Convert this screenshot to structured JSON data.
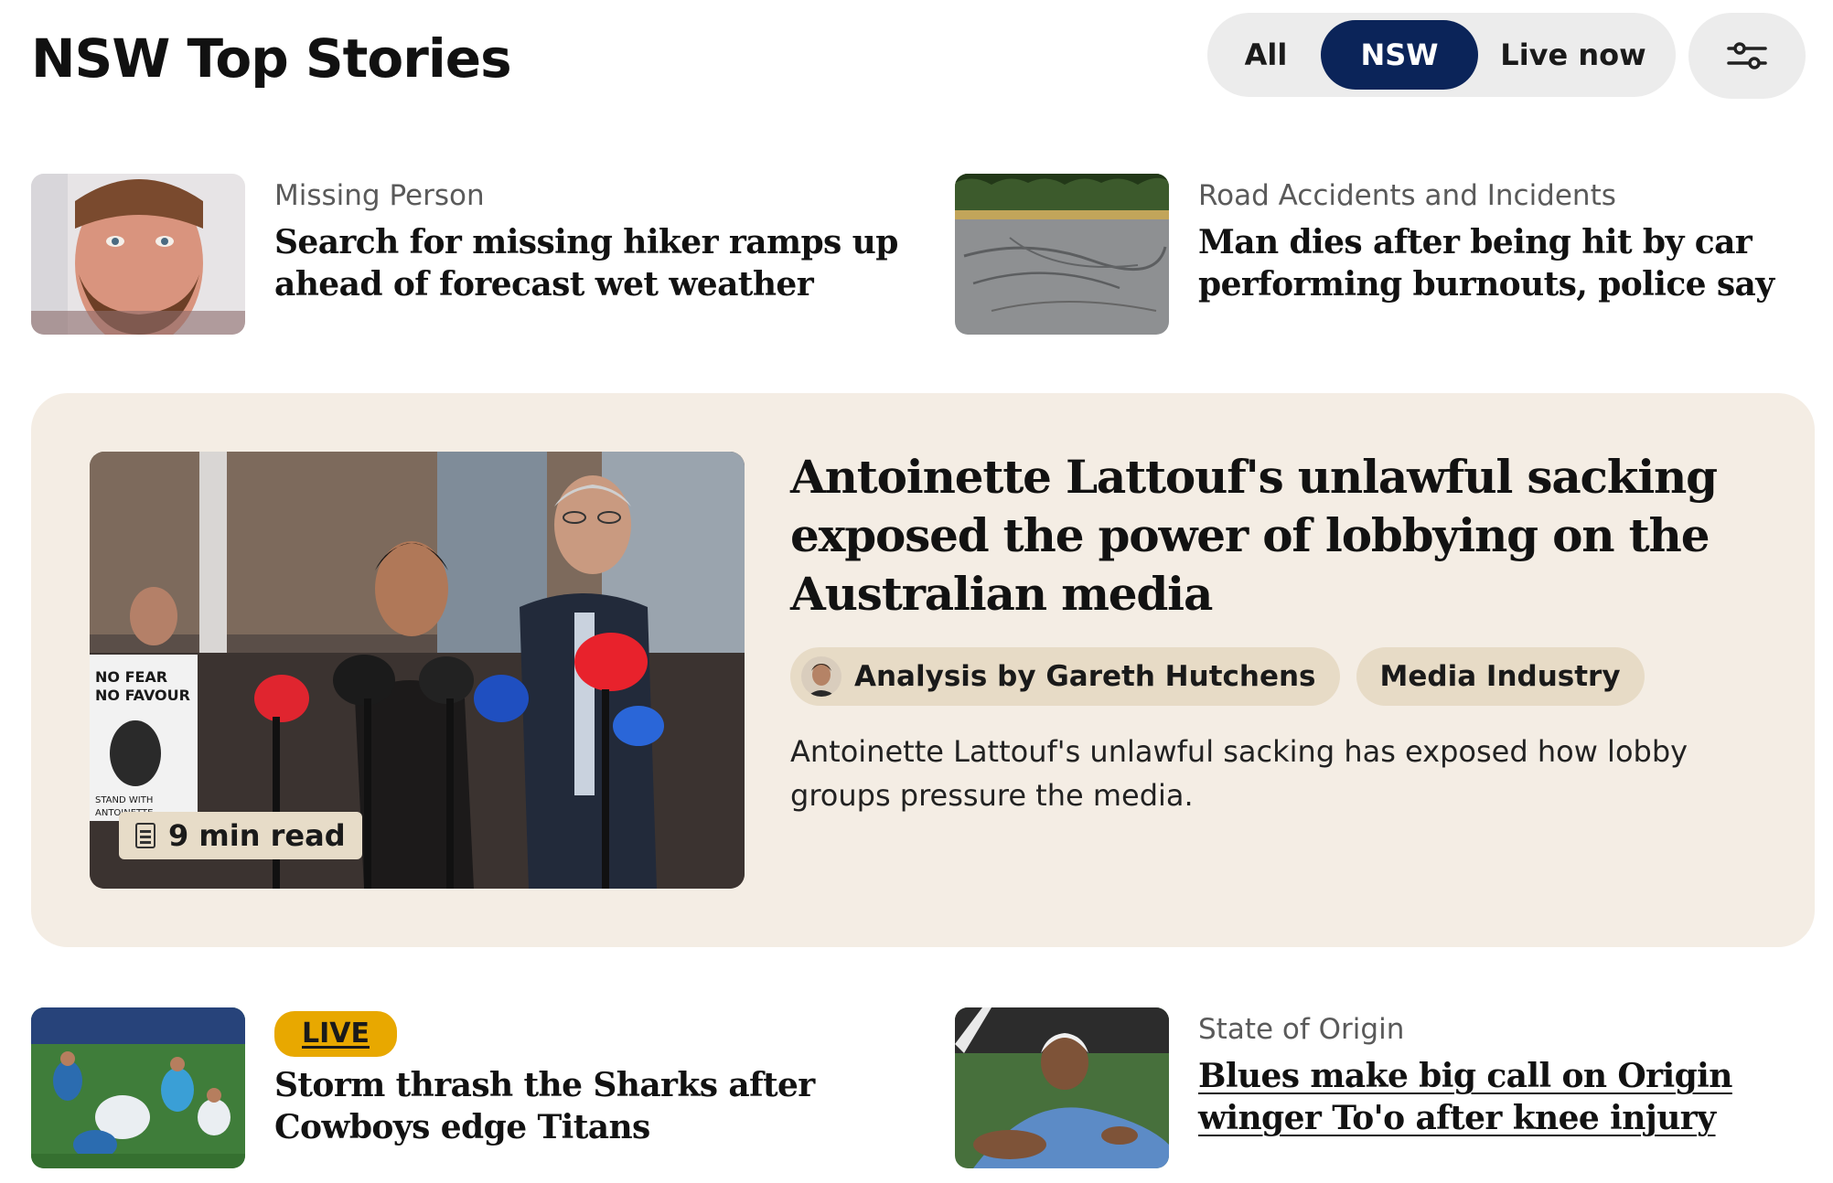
{
  "header": {
    "title": "NSW Top Stories",
    "filters": [
      {
        "label": "All",
        "selected": false
      },
      {
        "label": "NSW",
        "selected": true
      },
      {
        "label": "Live now",
        "selected": false
      }
    ],
    "settings_icon": "sliders-icon"
  },
  "stories": [
    {
      "kicker": "Missing Person",
      "headline": "Search for missing hiker ramps up ahead of forecast wet weather"
    },
    {
      "kicker": "Road Accidents and Incidents",
      "headline": "Man dies after being hit by car performing burnouts, police say"
    },
    {
      "badge": "LIVE",
      "headline": "Storm thrash the Sharks after Cowboys edge Titans"
    },
    {
      "kicker": "State of Origin",
      "headline": "Blues make big call on Origin winger To'o after knee injury"
    }
  ],
  "feature": {
    "headline": "Antoinette Lattouf's unlawful sacking exposed the power of lobbying on the Australian media",
    "read_time": "9 min read",
    "author_tag": "Analysis by Gareth Hutchens",
    "topic_tag": "Media Industry",
    "description": "Antoinette Lattouf's unlawful sacking has exposed how lobby groups pressure the media."
  },
  "colors": {
    "selected_filter_bg": "#0b2459",
    "feature_bg": "#f4ede4",
    "tag_bg": "#e7dbc6",
    "live_badge": "#e8a800"
  }
}
